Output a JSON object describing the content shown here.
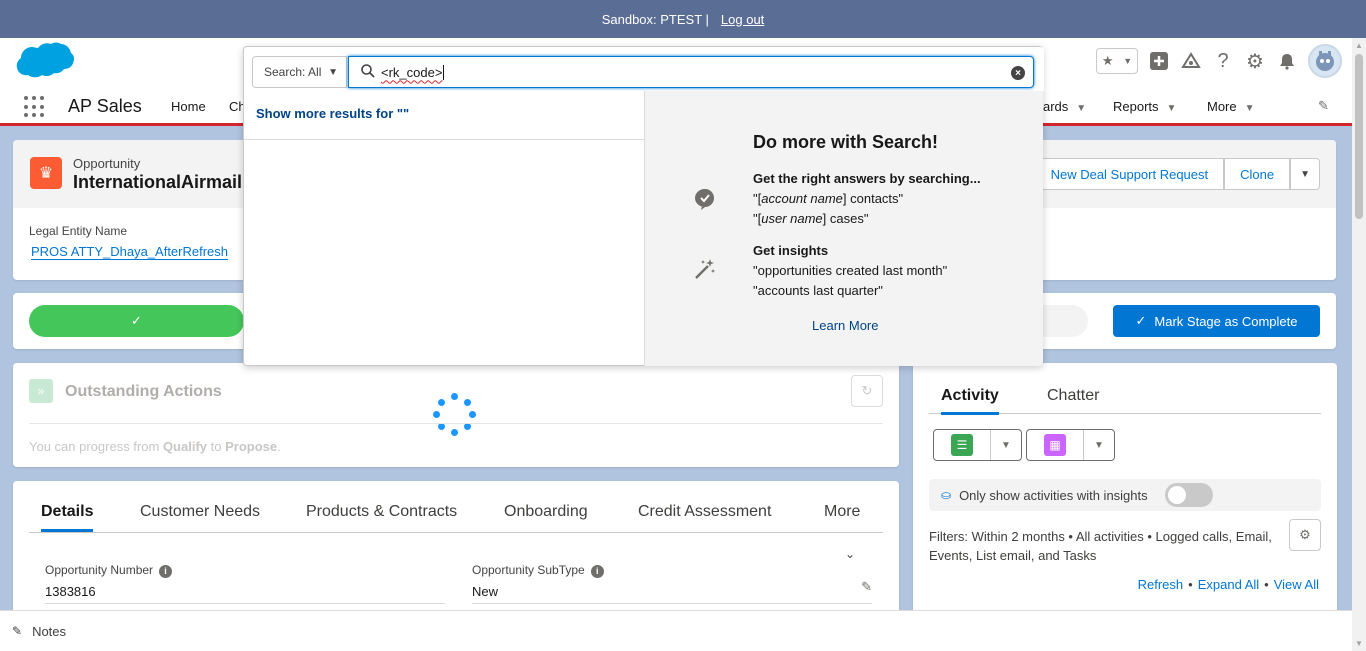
{
  "sandbox": {
    "text": "Sandbox: PTEST |",
    "logout": "Log out"
  },
  "nav": {
    "app_name": "AP Sales",
    "items": [
      "Home",
      "Ch",
      "ards",
      "Reports",
      "More"
    ]
  },
  "record": {
    "type": "Opportunity",
    "name": "InternationalAirmail",
    "buttons": [
      "New Deal Support Request",
      "Clone"
    ],
    "legal_entity_label": "Legal Entity Name",
    "legal_entity_value": "PROS ATTY_Dhaya_AfterRefresh"
  },
  "path": {
    "mark_complete": "Mark Stage as Complete"
  },
  "outstanding": {
    "title": "Outstanding Actions",
    "info_prefix": "You can progress from ",
    "from_stage": "Qualify",
    "info_mid": " to ",
    "to_stage": "Propose",
    "info_suffix": "."
  },
  "tabs": [
    "Details",
    "Customer Needs",
    "Products & Contracts",
    "Onboarding",
    "Credit Assessment",
    "More"
  ],
  "fields": {
    "opp_number_label": "Opportunity Number",
    "opp_number_value": "1383816",
    "subtype_label": "Opportunity SubType",
    "subtype_value": "New"
  },
  "activity": {
    "tabs": [
      "Activity",
      "Chatter"
    ],
    "insights_label": "Only show activities with insights",
    "filters": "Filters: Within 2 months • All activities • Logged calls, Email, Events, List email, and Tasks",
    "links": [
      "Refresh",
      "Expand All",
      "View All"
    ]
  },
  "footer": {
    "notes": "Notes"
  },
  "search": {
    "scope": "Search: All",
    "query": "<rk_code>",
    "show_more": "Show more results for \"\"",
    "title": "Do more with Search!",
    "block1_heading": "Get the right answers by searching...",
    "block1_line1_italic": "account name",
    "block1_line1_rest": "] contacts\"",
    "block1_line2_italic": "user name",
    "block1_line2_rest": "] cases\"",
    "block2_heading": "Get insights",
    "block2_line1": "\"opportunities created last month\"",
    "block2_line2": "\"accounts last quarter\"",
    "learn_more": "Learn More"
  },
  "colors": {
    "accent": "#0176d3",
    "success": "#45c65a",
    "brand_red": "#d3262e",
    "sandbox_bar": "#5a6d94"
  }
}
